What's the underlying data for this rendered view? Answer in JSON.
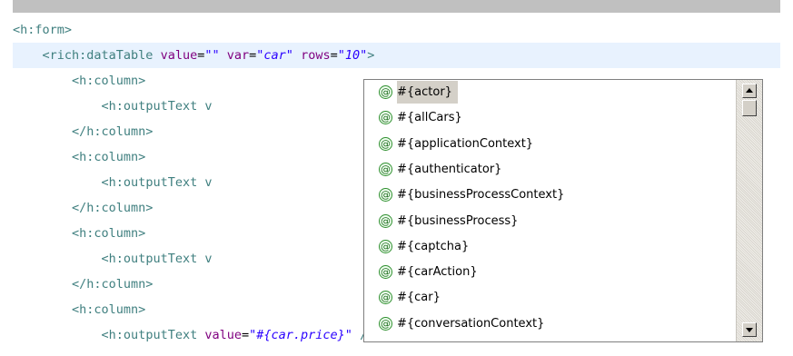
{
  "editor": {
    "lines": [
      {
        "indent": "",
        "tag": "<h:form>",
        "attrs": [],
        "tail": ""
      },
      {
        "indent": "    ",
        "tag": "<rich:dataTable",
        "attrs": [
          {
            "name": "value",
            "value": "\"\""
          },
          {
            "name": "var",
            "value": "\"car\""
          },
          {
            "name": "rows",
            "value": "\"10\""
          }
        ],
        "tail": ">"
      },
      {
        "indent": "        ",
        "tag": "<h:column>",
        "attrs": [],
        "tail": ""
      },
      {
        "indent": "            ",
        "tag": "<h:outputText v",
        "attrs": [],
        "tail": ""
      },
      {
        "indent": "        ",
        "tag": "</h:column>",
        "attrs": [],
        "tail": ""
      },
      {
        "indent": "        ",
        "tag": "<h:column>",
        "attrs": [],
        "tail": ""
      },
      {
        "indent": "            ",
        "tag": "<h:outputText v",
        "attrs": [],
        "tail": ""
      },
      {
        "indent": "        ",
        "tag": "</h:column>",
        "attrs": [],
        "tail": ""
      },
      {
        "indent": "        ",
        "tag": "<h:column>",
        "attrs": [],
        "tail": ""
      },
      {
        "indent": "            ",
        "tag": "<h:outputText v",
        "attrs": [],
        "tail": ""
      },
      {
        "indent": "        ",
        "tag": "</h:column>",
        "attrs": [],
        "tail": ""
      },
      {
        "indent": "        ",
        "tag": "<h:column>",
        "attrs": [],
        "tail": ""
      },
      {
        "indent": "            ",
        "tag": "<h:outputText",
        "attrs": [
          {
            "name": "value",
            "value": "\"#{car.price}\""
          }
        ],
        "tail": " />"
      }
    ],
    "current_line": 1
  },
  "autocomplete": {
    "badge_glyph": "@",
    "items": [
      "#{actor}",
      "#{allCars}",
      "#{applicationContext}",
      "#{authenticator}",
      "#{businessProcessContext}",
      "#{businessProcess}",
      "#{captcha}",
      "#{carAction}",
      "#{car}",
      "#{conversationContext}"
    ],
    "selected_index": 0
  },
  "icons": {
    "item_icon": "at-sign-icon",
    "scroll_up": "arrow-up-icon",
    "scroll_down": "arrow-down-icon"
  },
  "colors": {
    "tag": "#3f7f7f",
    "attribute": "#7f007f",
    "string": "#2a00ff",
    "current_line": "#e8f2fe",
    "selection": "#d4d0c8"
  }
}
